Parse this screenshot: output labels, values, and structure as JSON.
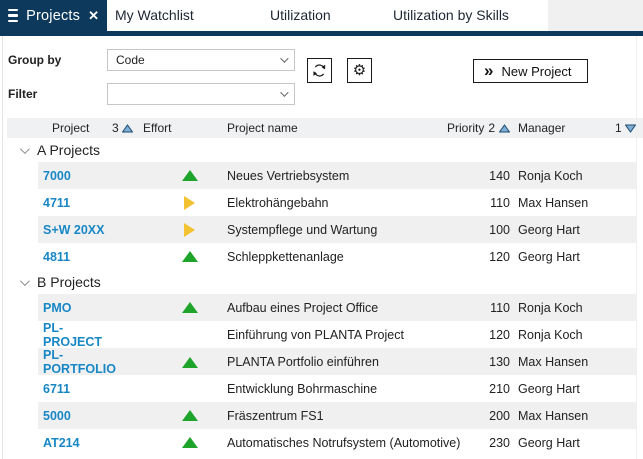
{
  "tabs": {
    "active": {
      "label": "Projects",
      "close": "✕"
    },
    "items": [
      {
        "label": "My Watchlist"
      },
      {
        "label": "Utilization"
      },
      {
        "label": "Utilization by Skills"
      }
    ]
  },
  "toolbar": {
    "group_by_label": "Group by",
    "group_by_value": "Code",
    "filter_label": "Filter",
    "filter_value": "",
    "refresh_icon": "refresh-icon",
    "settings_icon": "gear-icon",
    "new_project_icon": "»",
    "new_project_label": "New Project"
  },
  "table": {
    "headers": {
      "project": "Project",
      "project_sort_order": "3",
      "effort": "Effort",
      "name": "Project name",
      "priority": "Priority",
      "priority_sort_order": "2",
      "manager": "Manager",
      "row_sort_order": "1"
    },
    "groups": [
      {
        "label": "A Projects",
        "rows": [
          {
            "id": "7000",
            "effort_icon": "trend-up-green",
            "name": "Neues Vertriebsystem",
            "priority": "140",
            "manager": "Ronja Koch"
          },
          {
            "id": "4711",
            "effort_icon": "trend-right-yellow",
            "name": "Elektrohängebahn",
            "priority": "110",
            "manager": "Max Hansen"
          },
          {
            "id": "S+W 20XX",
            "effort_icon": "trend-right-yellow",
            "name": "Systempflege und Wartung",
            "priority": "100",
            "manager": "Georg Hart"
          },
          {
            "id": "4811",
            "effort_icon": "trend-up-green",
            "name": "Schleppkettenanlage",
            "priority": "120",
            "manager": "Georg Hart"
          }
        ]
      },
      {
        "label": "B Projects",
        "rows": [
          {
            "id": "PMO",
            "effort_icon": "trend-up-green",
            "name": "Aufbau eines Project Office",
            "priority": "110",
            "manager": "Ronja Koch"
          },
          {
            "id": "PL-PROJECT",
            "effort_icon": "none",
            "name": "Einführung von PLANTA Project",
            "priority": "120",
            "manager": "Ronja Koch"
          },
          {
            "id": "PL-PORTFOLIO",
            "effort_icon": "trend-up-green",
            "name": "PLANTA Portfolio einführen",
            "priority": "130",
            "manager": "Max Hansen"
          },
          {
            "id": "6711",
            "effort_icon": "none",
            "name": "Entwicklung Bohrmaschine",
            "priority": "210",
            "manager": "Georg Hart"
          },
          {
            "id": "5000",
            "effort_icon": "trend-up-green",
            "name": "Fräszentrum FS1",
            "priority": "200",
            "manager": "Max Hansen"
          },
          {
            "id": "AT214",
            "effort_icon": "trend-up-green",
            "name": "Automatisches Notrufsystem (Automotive)",
            "priority": "230",
            "manager": "Georg Hart"
          }
        ]
      }
    ]
  },
  "colors": {
    "brand_navy": "#0d3a5c",
    "link_blue": "#1787c6",
    "effort_green": "#1ea32b",
    "effort_yellow": "#f2c230",
    "stripe_gray": "#f0f0f0",
    "header_gray": "#f0f1f3"
  }
}
